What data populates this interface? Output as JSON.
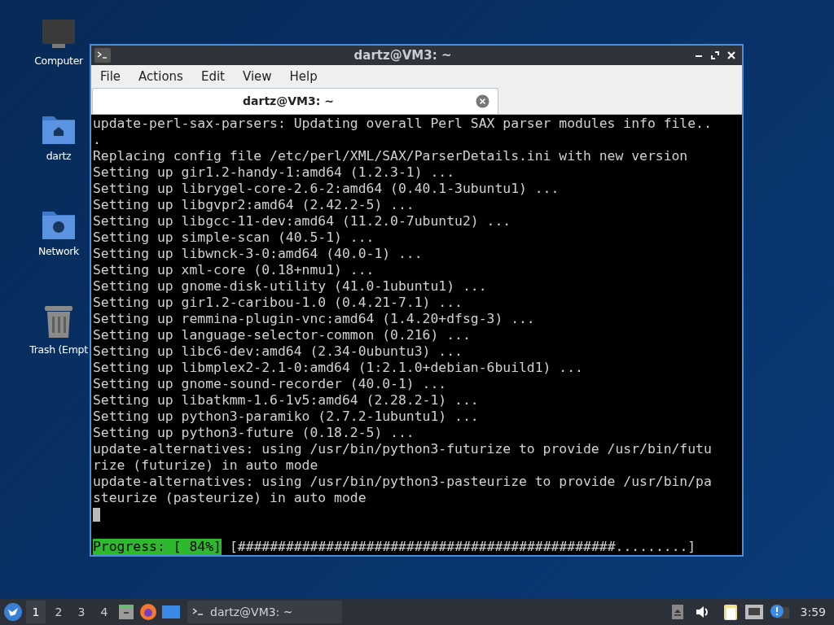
{
  "desktop_icons": [
    {
      "kind": "computer",
      "label": "Computer"
    },
    {
      "kind": "home",
      "label": "dartz"
    },
    {
      "kind": "network",
      "label": "Network"
    },
    {
      "kind": "trash",
      "label": "Trash (Empt"
    }
  ],
  "window": {
    "title": "dartz@VM3: ~",
    "menu": [
      "File",
      "Actions",
      "Edit",
      "View",
      "Help"
    ],
    "tabs": [
      {
        "label": "dartz@VM3: ~",
        "selected": true
      }
    ],
    "terminal": {
      "lines": [
        "update-perl-sax-parsers: Updating overall Perl SAX parser modules info file..",
        ".",
        "Replacing config file /etc/perl/XML/SAX/ParserDetails.ini with new version",
        "Setting up gir1.2-handy-1:amd64 (1.2.3-1) ...",
        "Setting up librygel-core-2.6-2:amd64 (0.40.1-3ubuntu1) ...",
        "Setting up libgvpr2:amd64 (2.42.2-5) ...",
        "Setting up libgcc-11-dev:amd64 (11.2.0-7ubuntu2) ...",
        "Setting up simple-scan (40.5-1) ...",
        "Setting up libwnck-3-0:amd64 (40.0-1) ...",
        "Setting up xml-core (0.18+nmu1) ...",
        "Setting up gnome-disk-utility (41.0-1ubuntu1) ...",
        "Setting up gir1.2-caribou-1.0 (0.4.21-7.1) ...",
        "Setting up remmina-plugin-vnc:amd64 (1.4.20+dfsg-3) ...",
        "Setting up language-selector-common (0.216) ...",
        "Setting up libc6-dev:amd64 (2.34-0ubuntu3) ...",
        "Setting up libmplex2-2.1-0:amd64 (1:2.1.0+debian-6build1) ...",
        "Setting up gnome-sound-recorder (40.0-1) ...",
        "Setting up libatkmm-1.6-1v5:amd64 (2.28.2-1) ...",
        "Setting up python3-paramiko (2.7.2-1ubuntu1) ...",
        "Setting up python3-future (0.18.2-5) ...",
        "update-alternatives: using /usr/bin/python3-futurize to provide /usr/bin/futu",
        "rize (futurize) in auto mode",
        "update-alternatives: using /usr/bin/python3-pasteurize to provide /usr/bin/pa",
        "steurize (pasteurize) in auto mode"
      ],
      "cursor": true,
      "progress": {
        "label": "Progress: [ 84%]",
        "bar": "[###############################################.........]"
      }
    }
  },
  "taskbar": {
    "workspaces": [
      {
        "label": "1",
        "selected": true
      },
      {
        "label": "2",
        "selected": false
      },
      {
        "label": "3",
        "selected": false
      },
      {
        "label": "4",
        "selected": false
      }
    ],
    "task": {
      "label": "dartz@VM3: ~"
    },
    "clock": "3:59"
  }
}
